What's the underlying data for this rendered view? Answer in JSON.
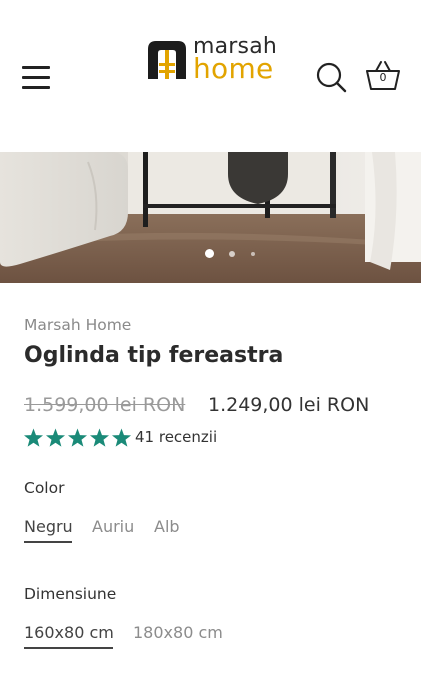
{
  "header": {
    "brand_top": "marsah",
    "brand_bottom": "home",
    "brand_color": "#e2a400",
    "menu_icon": "hamburger-icon",
    "search_icon": "search-icon",
    "cart_icon": "basket-icon",
    "cart_count": "0"
  },
  "gallery": {
    "slides": 3,
    "active_slide": 1
  },
  "product": {
    "vendor": "Marsah Home",
    "title": "Oglinda tip fereastra",
    "price_old": "1.599,00 lei RON",
    "price_new": "1.249,00 lei RON",
    "rating": 5,
    "star_color": "#1a8a78",
    "reviews": "41 recenzii"
  },
  "options": {
    "color_label": "Color",
    "colors": [
      "Negru",
      "Auriu",
      "Alb"
    ],
    "color_selected": "Negru",
    "size_label": "Dimensiune",
    "sizes": [
      "160x80 cm",
      "180x80 cm"
    ],
    "size_selected": "160x80 cm"
  }
}
